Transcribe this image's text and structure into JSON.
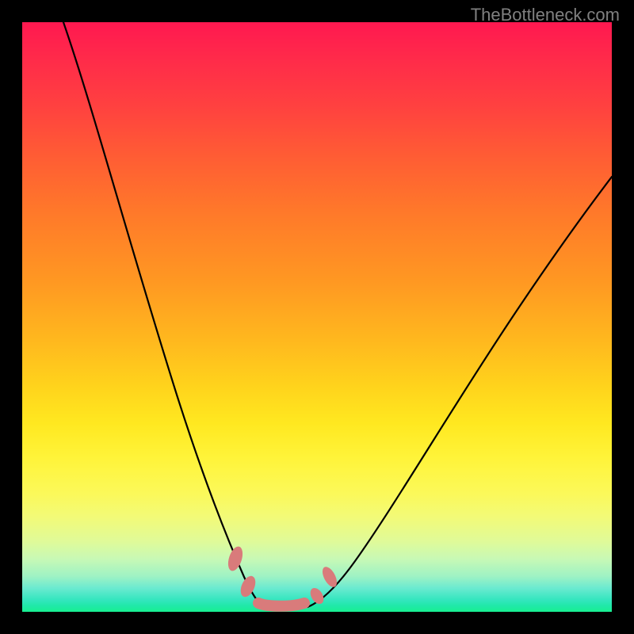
{
  "watermark": "TheBottleneck.com",
  "chart_data": {
    "type": "line",
    "title": "",
    "xlabel": "",
    "ylabel": "",
    "xlim": [
      0,
      100
    ],
    "ylim": [
      0,
      100
    ],
    "note": "Bottleneck valley curve: x is relative component balance, y is bottleneck percentage. Values estimated from pixel positions; chart has no tick labels.",
    "series": [
      {
        "name": "left-branch",
        "x": [
          7,
          12,
          18,
          24,
          28,
          32,
          35,
          38,
          40
        ],
        "values": [
          100,
          86,
          68,
          48,
          32,
          18,
          8,
          3,
          2
        ]
      },
      {
        "name": "right-branch",
        "x": [
          48,
          52,
          56,
          60,
          66,
          74,
          84,
          94,
          100
        ],
        "values": [
          2,
          3,
          7,
          14,
          26,
          42,
          60,
          72,
          78
        ]
      },
      {
        "name": "optimal-band",
        "x": [
          40,
          42,
          44,
          46,
          48
        ],
        "values": [
          2,
          1.5,
          1.5,
          1.5,
          2
        ]
      }
    ],
    "markers": [
      {
        "name": "left-marker-upper",
        "x": 35,
        "y": 8
      },
      {
        "name": "left-marker-lower",
        "x": 38,
        "y": 3
      },
      {
        "name": "right-marker-upper",
        "x": 52,
        "y": 4
      },
      {
        "name": "right-marker-lower",
        "x": 50,
        "y": 2.5
      }
    ],
    "colors": {
      "curve": "#000000",
      "marker": "#d97b7b",
      "gradient_top": "#ff1850",
      "gradient_bottom": "#18f090"
    }
  }
}
